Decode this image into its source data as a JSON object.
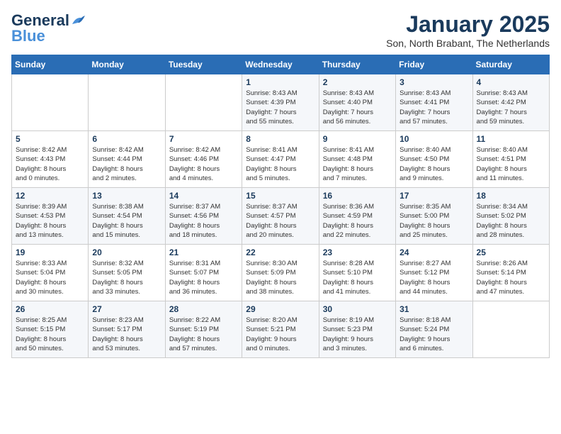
{
  "logo": {
    "line1": "General",
    "line2": "Blue"
  },
  "title": "January 2025",
  "location": "Son, North Brabant, The Netherlands",
  "weekdays": [
    "Sunday",
    "Monday",
    "Tuesday",
    "Wednesday",
    "Thursday",
    "Friday",
    "Saturday"
  ],
  "weeks": [
    [
      {
        "day": "",
        "info": ""
      },
      {
        "day": "",
        "info": ""
      },
      {
        "day": "",
        "info": ""
      },
      {
        "day": "1",
        "info": "Sunrise: 8:43 AM\nSunset: 4:39 PM\nDaylight: 7 hours\nand 55 minutes."
      },
      {
        "day": "2",
        "info": "Sunrise: 8:43 AM\nSunset: 4:40 PM\nDaylight: 7 hours\nand 56 minutes."
      },
      {
        "day": "3",
        "info": "Sunrise: 8:43 AM\nSunset: 4:41 PM\nDaylight: 7 hours\nand 57 minutes."
      },
      {
        "day": "4",
        "info": "Sunrise: 8:43 AM\nSunset: 4:42 PM\nDaylight: 7 hours\nand 59 minutes."
      }
    ],
    [
      {
        "day": "5",
        "info": "Sunrise: 8:42 AM\nSunset: 4:43 PM\nDaylight: 8 hours\nand 0 minutes."
      },
      {
        "day": "6",
        "info": "Sunrise: 8:42 AM\nSunset: 4:44 PM\nDaylight: 8 hours\nand 2 minutes."
      },
      {
        "day": "7",
        "info": "Sunrise: 8:42 AM\nSunset: 4:46 PM\nDaylight: 8 hours\nand 4 minutes."
      },
      {
        "day": "8",
        "info": "Sunrise: 8:41 AM\nSunset: 4:47 PM\nDaylight: 8 hours\nand 5 minutes."
      },
      {
        "day": "9",
        "info": "Sunrise: 8:41 AM\nSunset: 4:48 PM\nDaylight: 8 hours\nand 7 minutes."
      },
      {
        "day": "10",
        "info": "Sunrise: 8:40 AM\nSunset: 4:50 PM\nDaylight: 8 hours\nand 9 minutes."
      },
      {
        "day": "11",
        "info": "Sunrise: 8:40 AM\nSunset: 4:51 PM\nDaylight: 8 hours\nand 11 minutes."
      }
    ],
    [
      {
        "day": "12",
        "info": "Sunrise: 8:39 AM\nSunset: 4:53 PM\nDaylight: 8 hours\nand 13 minutes."
      },
      {
        "day": "13",
        "info": "Sunrise: 8:38 AM\nSunset: 4:54 PM\nDaylight: 8 hours\nand 15 minutes."
      },
      {
        "day": "14",
        "info": "Sunrise: 8:37 AM\nSunset: 4:56 PM\nDaylight: 8 hours\nand 18 minutes."
      },
      {
        "day": "15",
        "info": "Sunrise: 8:37 AM\nSunset: 4:57 PM\nDaylight: 8 hours\nand 20 minutes."
      },
      {
        "day": "16",
        "info": "Sunrise: 8:36 AM\nSunset: 4:59 PM\nDaylight: 8 hours\nand 22 minutes."
      },
      {
        "day": "17",
        "info": "Sunrise: 8:35 AM\nSunset: 5:00 PM\nDaylight: 8 hours\nand 25 minutes."
      },
      {
        "day": "18",
        "info": "Sunrise: 8:34 AM\nSunset: 5:02 PM\nDaylight: 8 hours\nand 28 minutes."
      }
    ],
    [
      {
        "day": "19",
        "info": "Sunrise: 8:33 AM\nSunset: 5:04 PM\nDaylight: 8 hours\nand 30 minutes."
      },
      {
        "day": "20",
        "info": "Sunrise: 8:32 AM\nSunset: 5:05 PM\nDaylight: 8 hours\nand 33 minutes."
      },
      {
        "day": "21",
        "info": "Sunrise: 8:31 AM\nSunset: 5:07 PM\nDaylight: 8 hours\nand 36 minutes."
      },
      {
        "day": "22",
        "info": "Sunrise: 8:30 AM\nSunset: 5:09 PM\nDaylight: 8 hours\nand 38 minutes."
      },
      {
        "day": "23",
        "info": "Sunrise: 8:28 AM\nSunset: 5:10 PM\nDaylight: 8 hours\nand 41 minutes."
      },
      {
        "day": "24",
        "info": "Sunrise: 8:27 AM\nSunset: 5:12 PM\nDaylight: 8 hours\nand 44 minutes."
      },
      {
        "day": "25",
        "info": "Sunrise: 8:26 AM\nSunset: 5:14 PM\nDaylight: 8 hours\nand 47 minutes."
      }
    ],
    [
      {
        "day": "26",
        "info": "Sunrise: 8:25 AM\nSunset: 5:15 PM\nDaylight: 8 hours\nand 50 minutes."
      },
      {
        "day": "27",
        "info": "Sunrise: 8:23 AM\nSunset: 5:17 PM\nDaylight: 8 hours\nand 53 minutes."
      },
      {
        "day": "28",
        "info": "Sunrise: 8:22 AM\nSunset: 5:19 PM\nDaylight: 8 hours\nand 57 minutes."
      },
      {
        "day": "29",
        "info": "Sunrise: 8:20 AM\nSunset: 5:21 PM\nDaylight: 9 hours\nand 0 minutes."
      },
      {
        "day": "30",
        "info": "Sunrise: 8:19 AM\nSunset: 5:23 PM\nDaylight: 9 hours\nand 3 minutes."
      },
      {
        "day": "31",
        "info": "Sunrise: 8:18 AM\nSunset: 5:24 PM\nDaylight: 9 hours\nand 6 minutes."
      },
      {
        "day": "",
        "info": ""
      }
    ]
  ]
}
